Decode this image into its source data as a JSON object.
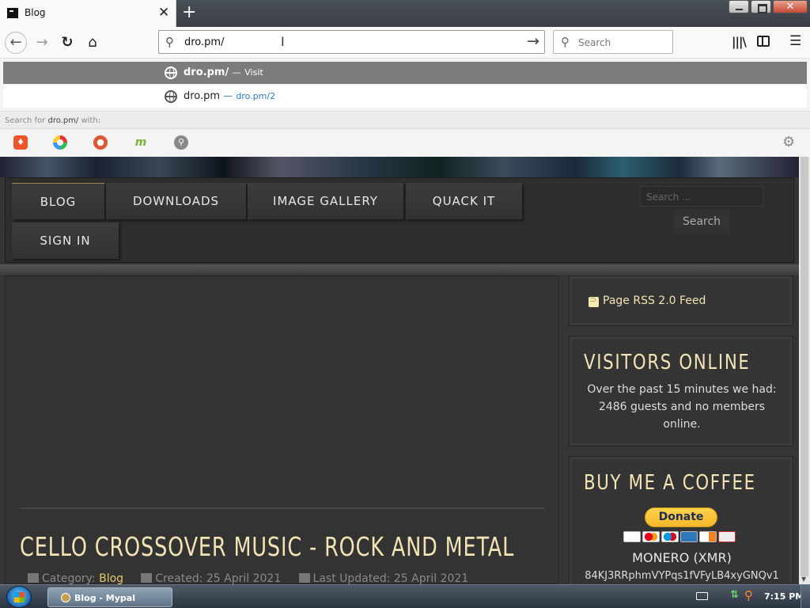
{
  "browser": {
    "tab_title": "Blog",
    "tab_close": "✕",
    "new_tab": "+",
    "url": "dro.pm/",
    "search_placeholder": "Search",
    "icons": [
      "back-icon",
      "forward-icon",
      "reload-icon",
      "home-icon",
      "library-icon",
      "sidebar-icon",
      "menu-icon"
    ]
  },
  "dropdown": {
    "suggestions": [
      {
        "title": "dro.pm/",
        "sep": "—",
        "action": "Visit"
      },
      {
        "title": "dro.pm",
        "sep": "—",
        "action": "dro.pm/2"
      }
    ],
    "search_for_prefix": "Search for",
    "search_for_query": "dro.pm/",
    "search_for_suffix": "with:",
    "engines": [
      "brave",
      "qwant",
      "duckduckgo",
      "mojeek",
      "search"
    ]
  },
  "site": {
    "nav": {
      "blog": "BLOG",
      "downloads": "DOWNLOADS",
      "gallery": "IMAGE GALLERY",
      "quack": "QUACK IT",
      "signin": "SIGN IN"
    },
    "search_placeholder": "Search ...",
    "search_button": "Search",
    "article": {
      "title": "CELLO CROSSOVER MUSIC - ROCK AND METAL",
      "category_label": "Category:",
      "category": "Blog",
      "created": "Created: 25 April 2021",
      "updated": "Last Updated: 25 April 2021"
    },
    "sidebar": {
      "rss": "Page RSS 2.0 Feed",
      "visitors_title": "VISITORS ONLINE",
      "visitors_text": "Over the past 15 minutes we had: 2486 guests and no members online.",
      "coffee_title": "BUY ME A COFFEE",
      "donate": "Donate",
      "monero_label": "MONERO (XMR)",
      "monero_address": "84KJ3RRphmVYPqs1fVFyLB4xyGNQv1"
    }
  },
  "taskbar": {
    "task_label": "Blog - Mypal",
    "clock": "7:15 PM"
  }
}
